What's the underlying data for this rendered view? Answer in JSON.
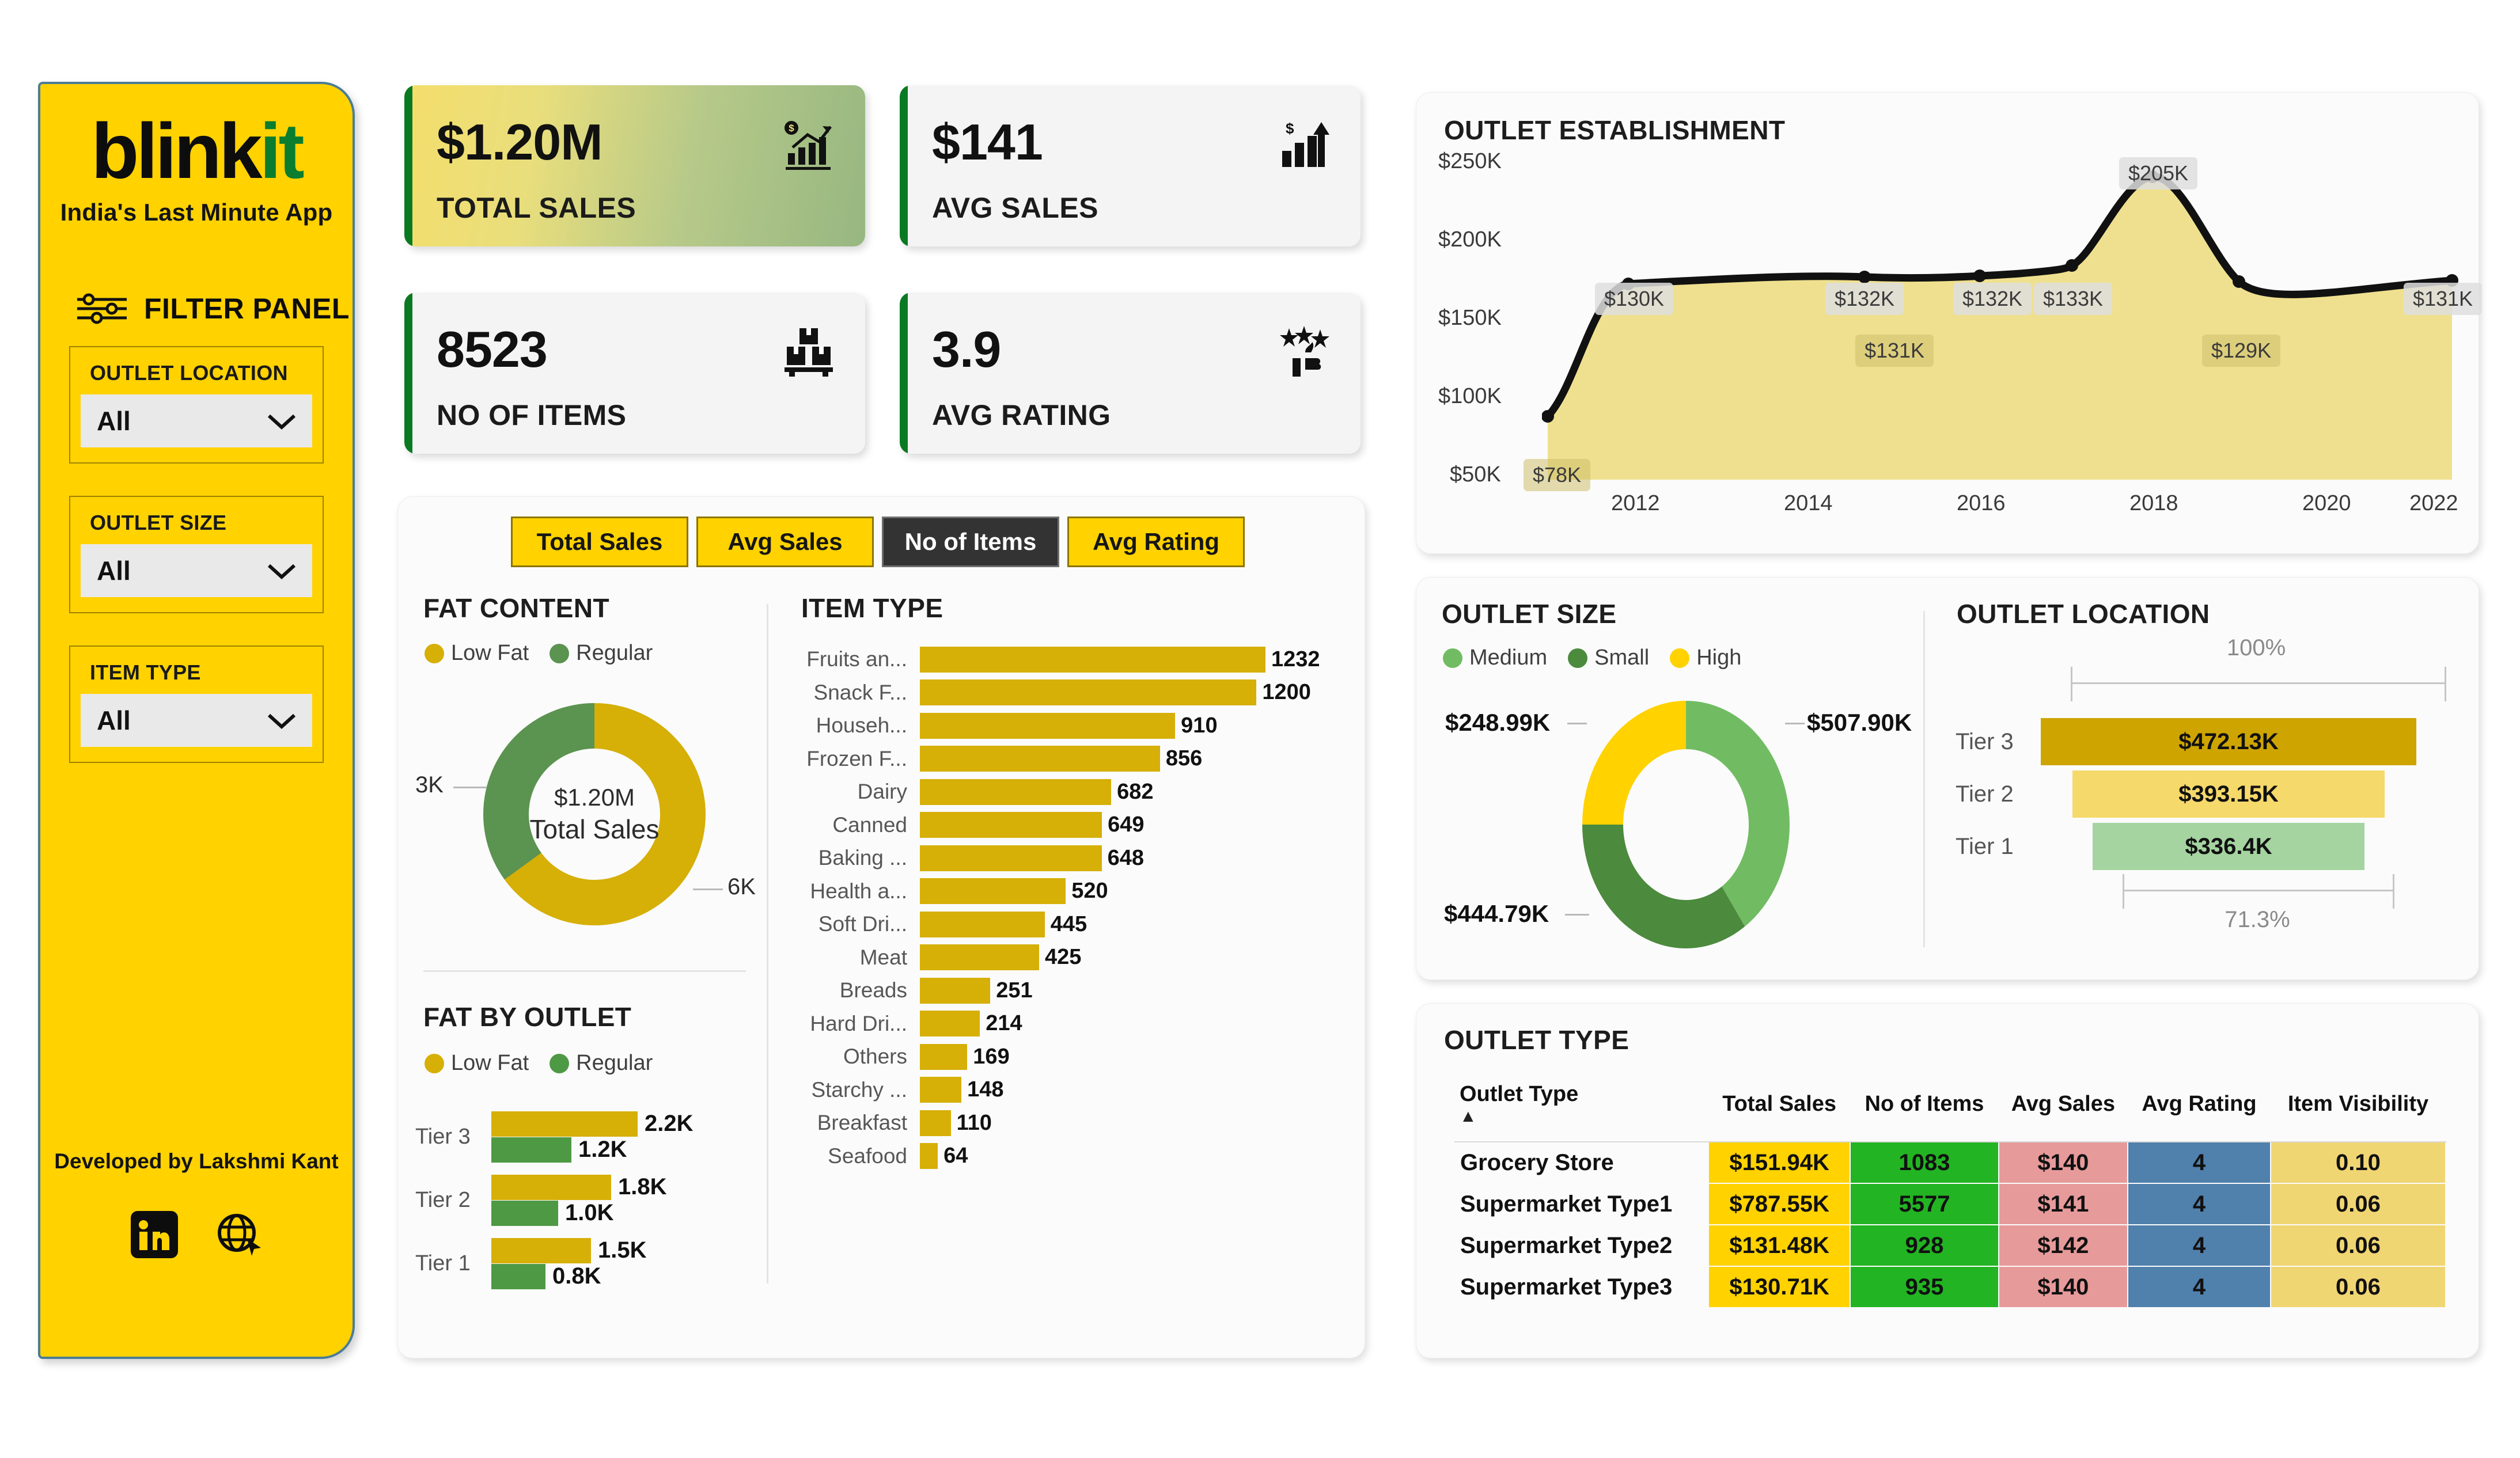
{
  "brand": {
    "name_part1": "blink",
    "name_part2": "it",
    "tagline": "India's Last Minute App",
    "yellow": "#FFD200",
    "green": "#0a7d2e"
  },
  "sidebar": {
    "filter_panel_title": "FILTER PANEL",
    "slicers": [
      {
        "label": "OUTLET LOCATION",
        "value": "All"
      },
      {
        "label": "OUTLET SIZE",
        "value": "All"
      },
      {
        "label": "ITEM TYPE",
        "value": "All"
      }
    ],
    "credit": "Developed by Lakshmi Kant",
    "social": [
      "linkedin-icon",
      "globe-icon"
    ]
  },
  "kpis": [
    {
      "value": "$1.20M",
      "label": "TOTAL SALES",
      "icon": "sales-growth-icon"
    },
    {
      "value": "$141",
      "label": "AVG SALES",
      "icon": "dollar-bar-icon"
    },
    {
      "value": "8523",
      "label": "NO OF ITEMS",
      "icon": "boxes-icon"
    },
    {
      "value": "3.9",
      "label": "AVG RATING",
      "icon": "star-thumbsup-icon"
    }
  ],
  "tabs": [
    {
      "label": "Total Sales",
      "active": false
    },
    {
      "label": "Avg Sales",
      "active": false
    },
    {
      "label": "No of Items",
      "active": true
    },
    {
      "label": "Avg Rating",
      "active": false
    }
  ],
  "panels": {
    "fat_content": "FAT CONTENT",
    "item_type": "ITEM TYPE",
    "fat_by_outlet": "FAT BY OUTLET",
    "outlet_establishment": "OUTLET ESTABLISHMENT",
    "outlet_size": "OUTLET SIZE",
    "outlet_location": "OUTLET LOCATION",
    "outlet_type": "OUTLET TYPE"
  },
  "chart_data": [
    {
      "type": "pie",
      "title": "FAT CONTENT",
      "center_value": "$1.20M",
      "center_label": "Total Sales",
      "legend": [
        {
          "name": "Low Fat",
          "color": "#D6AF07"
        },
        {
          "name": "Regular",
          "color": "#5b9350"
        }
      ],
      "labels": [
        "Low Fat",
        "Regular"
      ],
      "values": [
        6000,
        3000
      ],
      "display_labels": [
        "6K",
        "3K"
      ],
      "legend_position": "top-left"
    },
    {
      "type": "bar",
      "title": "ITEM TYPE",
      "orientation": "horizontal",
      "xlabel": "",
      "ylabel": "",
      "categories": [
        "Fruits an...",
        "Snack F...",
        "Househ...",
        "Frozen F...",
        "Dairy",
        "Canned",
        "Baking ...",
        "Health a...",
        "Soft Dri...",
        "Meat",
        "Breads",
        "Hard Dri...",
        "Others",
        "Starchy ...",
        "Breakfast",
        "Seafood"
      ],
      "values": [
        1232,
        1200,
        910,
        856,
        682,
        649,
        648,
        520,
        445,
        425,
        251,
        214,
        169,
        148,
        110,
        64
      ],
      "bar_color": "#D6AF07",
      "grid": false
    },
    {
      "type": "bar",
      "title": "FAT BY OUTLET",
      "orientation": "horizontal",
      "categories": [
        "Tier 3",
        "Tier 2",
        "Tier 1"
      ],
      "series": [
        {
          "name": "Low Fat",
          "color": "#D6AF07",
          "values": [
            2200,
            1800,
            1500
          ],
          "display": [
            "2.2K",
            "1.8K",
            "1.5K"
          ]
        },
        {
          "name": "Regular",
          "color": "#4e9944",
          "values": [
            1200,
            1000,
            800
          ],
          "display": [
            "1.2K",
            "1.0K",
            "0.8K"
          ]
        }
      ],
      "grid": false
    },
    {
      "type": "area",
      "title": "OUTLET ESTABLISHMENT",
      "xlabel": "",
      "ylabel": "",
      "ylim": [
        50000,
        250000
      ],
      "ytick_labels": [
        "$250K",
        "$200K",
        "$150K",
        "$100K",
        "$50K"
      ],
      "xtick_labels": [
        "2012",
        "2014",
        "2016",
        "2018",
        "2020",
        "2022"
      ],
      "x": [
        2011,
        2012,
        2014,
        2015,
        2016,
        2017,
        2018,
        2020,
        2022
      ],
      "values": [
        78000,
        130000,
        132000,
        131000,
        132000,
        133000,
        205000,
        129000,
        131000
      ],
      "display_labels": [
        "$78K",
        "$130K",
        "$132K",
        "$131K",
        "$132K",
        "$133K",
        "$205K",
        "$129K",
        "$131K"
      ],
      "line_color": "#111111",
      "fill_color": "#EFE08F",
      "grid": false
    },
    {
      "type": "pie",
      "title": "OUTLET SIZE",
      "legend": [
        {
          "name": "Medium",
          "color": "#71BC63"
        },
        {
          "name": "Small",
          "color": "#4c8a3e"
        },
        {
          "name": "High",
          "color": "#FFD200"
        }
      ],
      "labels": [
        "Medium",
        "Small",
        "High"
      ],
      "values": [
        507900,
        444790,
        248990
      ],
      "display_labels": [
        "$507.90K",
        "$444.79K",
        "$248.99K"
      ],
      "legend_position": "top-left"
    },
    {
      "type": "bar",
      "title": "OUTLET LOCATION",
      "subtype": "funnel",
      "categories": [
        "Tier 3",
        "Tier 2",
        "Tier 1"
      ],
      "values": [
        472130,
        393150,
        336400
      ],
      "display_labels": [
        "$472.13K",
        "$393.15K",
        "$336.4K"
      ],
      "colors": [
        "#CEA400",
        "#F5D96A",
        "#A5D4A1"
      ],
      "top_pct": "100%",
      "bottom_pct": "71.3%"
    },
    {
      "type": "table",
      "title": "OUTLET TYPE",
      "columns": [
        "Outlet Type",
        "Total Sales",
        "No of Items",
        "Avg Sales",
        "Avg Rating",
        "Item Visibility"
      ],
      "sort_column": "Outlet Type",
      "sort_direction": "asc",
      "rows": [
        [
          "Grocery Store",
          "$151.94K",
          "1083",
          "$140",
          "4",
          "0.10"
        ],
        [
          "Supermarket Type1",
          "$787.55K",
          "5577",
          "$141",
          "4",
          "0.06"
        ],
        [
          "Supermarket Type2",
          "$131.48K",
          "928",
          "$142",
          "4",
          "0.06"
        ],
        [
          "Supermarket Type3",
          "$130.71K",
          "935",
          "$140",
          "4",
          "0.06"
        ]
      ],
      "cell_colors": {
        "total_sales": "#FFD200",
        "no_of_items": "#22b422",
        "avg_sales": "#e79a9a",
        "avg_rating": "#5080ac",
        "item_visibility": "#F0D573"
      }
    }
  ]
}
